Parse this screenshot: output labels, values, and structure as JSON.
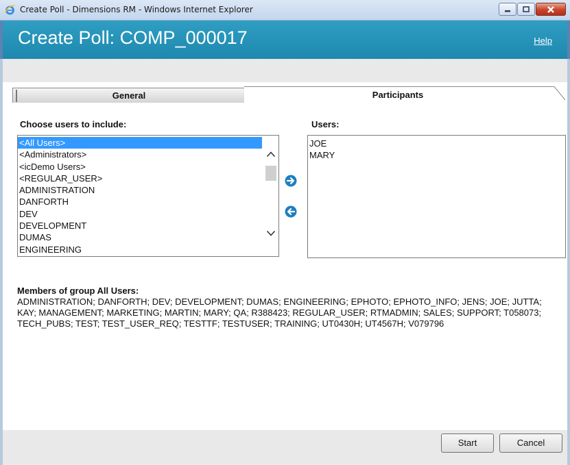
{
  "window": {
    "title": "Create Poll - Dimensions RM - Windows Internet Explorer",
    "app_icon": "internet-explorer-icon",
    "controls": [
      "minimize-icon",
      "maximize-icon",
      "close-icon"
    ]
  },
  "header": {
    "title": "Create Poll: COMP_000017",
    "help_label": "Help",
    "accent_color": "#2393b8"
  },
  "tabs": [
    {
      "label": "General",
      "active": false
    },
    {
      "label": "Participants",
      "active": true
    }
  ],
  "available": {
    "heading": "Choose users to include:",
    "items": [
      "<All Users>",
      "<Administrators>",
      "<icDemo Users>",
      "<REGULAR_USER>",
      "ADMINISTRATION",
      "DANFORTH",
      "DEV",
      "DEVELOPMENT",
      "DUMAS",
      "ENGINEERING"
    ],
    "selected_index": 0
  },
  "actions": {
    "add_icon": "arrow-right-icon",
    "remove_icon": "arrow-left-icon",
    "icon_color": "#1d7fc0"
  },
  "selected": {
    "heading": "Users:",
    "items": [
      "JOE",
      "MARY"
    ]
  },
  "members": {
    "heading": "Members of group All Users:",
    "text": "ADMINISTRATION; DANFORTH; DEV; DEVELOPMENT; DUMAS; ENGINEERING; EPHOTO; EPHOTO_INFO; JENS; JOE; JUTTA; KAY; MANAGEMENT; MARKETING; MARTIN; MARY; QA; R388423; REGULAR_USER; RTMADMIN; SALES; SUPPORT; T058073; TECH_PUBS; TEST; TEST_USER_REQ; TESTTF; TESTUSER; TRAINING; UT0430H; UT4567H; V079796"
  },
  "footer": {
    "start_label": "Start",
    "cancel_label": "Cancel"
  }
}
